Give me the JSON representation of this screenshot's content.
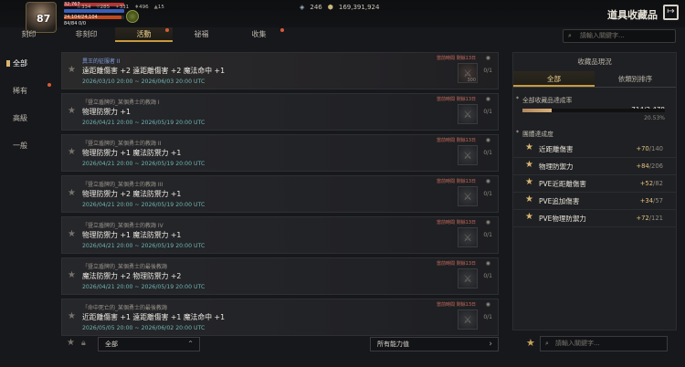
{
  "hud": {
    "level": "87",
    "hp_text": "32,767",
    "mp_text": "24,104/24,104",
    "sp_text": "84/84 0/0",
    "hp_fraction": 1.0,
    "mp_fraction": 1.0,
    "sp_fraction": 0.95,
    "stats": [
      "334",
      "285",
      "331",
      "496",
      "15"
    ],
    "currency": {
      "gem": "246",
      "gold": "169,391,924"
    }
  },
  "window": {
    "title": "道具收藏品",
    "close_icon": "exit-icon"
  },
  "tabs": [
    {
      "label": "刻印",
      "active": false,
      "dot": false
    },
    {
      "label": "非刻印",
      "active": false,
      "dot": false
    },
    {
      "label": "活動",
      "active": true,
      "dot": true
    },
    {
      "label": "祕福",
      "active": false,
      "dot": false
    },
    {
      "label": "收集",
      "active": false,
      "dot": true
    }
  ],
  "top_search": {
    "placeholder": "請輸入關鍵字..."
  },
  "left_nav": [
    {
      "label": "全部",
      "active": true,
      "dot": false
    },
    {
      "label": "稀有",
      "active": false,
      "dot": true
    },
    {
      "label": "高級",
      "active": false,
      "dot": false
    },
    {
      "label": "一般",
      "active": false,
      "dot": false
    }
  ],
  "rows": [
    {
      "subtitle": "異王的征服者 II",
      "stats": "遠距離傷害 +2 遠距離傷害 +2 魔法命中 +1",
      "date": "2026/03/10 20:00 ~ 2026/06/03 20:00 UTC",
      "pvp": "當前時間 剩餘13日",
      "count": "0/1",
      "item_num": "300",
      "first": true
    },
    {
      "subtitle": "「暨立盾牌的_某個勇士的教誨 I",
      "stats": "物理防禦力 +1",
      "date": "2026/04/21 20:00 ~ 2026/05/19 20:00 UTC",
      "pvp": "當前時間 剩餘13日",
      "count": "0/1",
      "item_num": "",
      "first": false
    },
    {
      "subtitle": "「暨立盾牌的_某個勇士的教誨 II",
      "stats": "物理防禦力 +1 魔法防禦力 +1",
      "date": "2026/04/21 20:00 ~ 2026/05/19 20:00 UTC",
      "pvp": "當前時間 剩餘13日",
      "count": "0/1",
      "item_num": "",
      "first": false
    },
    {
      "subtitle": "「暨立盾牌的_某個勇士的教誨 III",
      "stats": "物理防禦力 +2 魔法防禦力 +1",
      "date": "2026/04/21 20:00 ~ 2026/05/19 20:00 UTC",
      "pvp": "當前時間 剩餘13日",
      "count": "0/1",
      "item_num": "",
      "first": false
    },
    {
      "subtitle": "「暨立盾牌的_某個勇士的教誨 IV",
      "stats": "物理防禦力 +1 魔法防禦力 +1",
      "date": "2026/04/21 20:00 ~ 2026/05/19 20:00 UTC",
      "pvp": "當前時間 剩餘13日",
      "count": "0/1",
      "item_num": "",
      "first": false
    },
    {
      "subtitle": "「暨立盾牌的_某個勇士的最後教誨",
      "stats": "魔法防禦力 +2 物理防禦力 +2",
      "date": "2026/04/21 20:00 ~ 2026/05/19 20:00 UTC",
      "pvp": "當前時間 剩餘13日",
      "count": "0/1",
      "item_num": "",
      "first": false
    },
    {
      "subtitle": "「命中死亡的_某個勇士的最後教誨",
      "stats": "近距離傷害 +1 遠距離傷害 +1 魔法命中 +1",
      "date": "2026/05/05 20:00 ~ 2026/06/02 20:00 UTC",
      "pvp": "當前時間 剩餘13日",
      "count": "0/1",
      "item_num": "",
      "first": false
    }
  ],
  "bottom_left": {
    "filter": "全部",
    "ability": "所有能力值"
  },
  "panel": {
    "header": "收藏品現況",
    "tabs": [
      {
        "label": "全部",
        "active": true
      },
      {
        "label": "依類別排序",
        "active": false
      }
    ],
    "total_label": "全部收藏品達成率",
    "total_value": "714/3,478",
    "total_fraction": 0.2053,
    "total_pct": "20.53%",
    "group_label": "團體達成度",
    "groups": [
      {
        "label": "近距離傷害",
        "gain": "+70",
        "total": "/140"
      },
      {
        "label": "物理防禦力",
        "gain": "+84",
        "total": "/206"
      },
      {
        "label": "PVE近距離傷害",
        "gain": "+52",
        "total": "/82"
      },
      {
        "label": "PVE追加傷害",
        "gain": "+34",
        "total": "/57"
      },
      {
        "label": "PVE物理防禦力",
        "gain": "+72",
        "total": "/121"
      }
    ]
  },
  "bottom_search": {
    "placeholder": "請輸入關鍵字..."
  }
}
